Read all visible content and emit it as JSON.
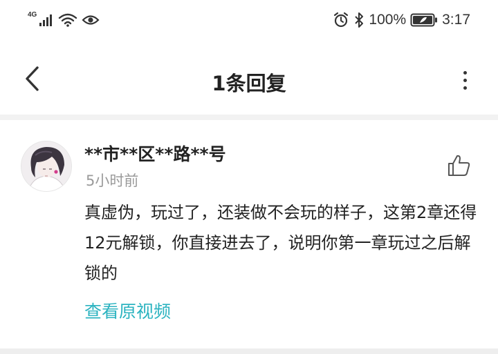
{
  "status_bar": {
    "network": "4G",
    "battery": "100%",
    "time": "3:17"
  },
  "header": {
    "title": "1条回复"
  },
  "comment": {
    "username": "**市**区**路**号",
    "time": "5小时前",
    "content": "真虚伪，玩过了，还装做不会玩的样子，这第2章还得12元解锁，你直接进去了，说明你第一章玩过之后解锁的",
    "view_video": "查看原视频"
  },
  "colors": {
    "accent": "#2bb3c0",
    "text_primary": "#222222",
    "text_secondary": "#9a9a9a",
    "divider": "#f2f2f2"
  }
}
